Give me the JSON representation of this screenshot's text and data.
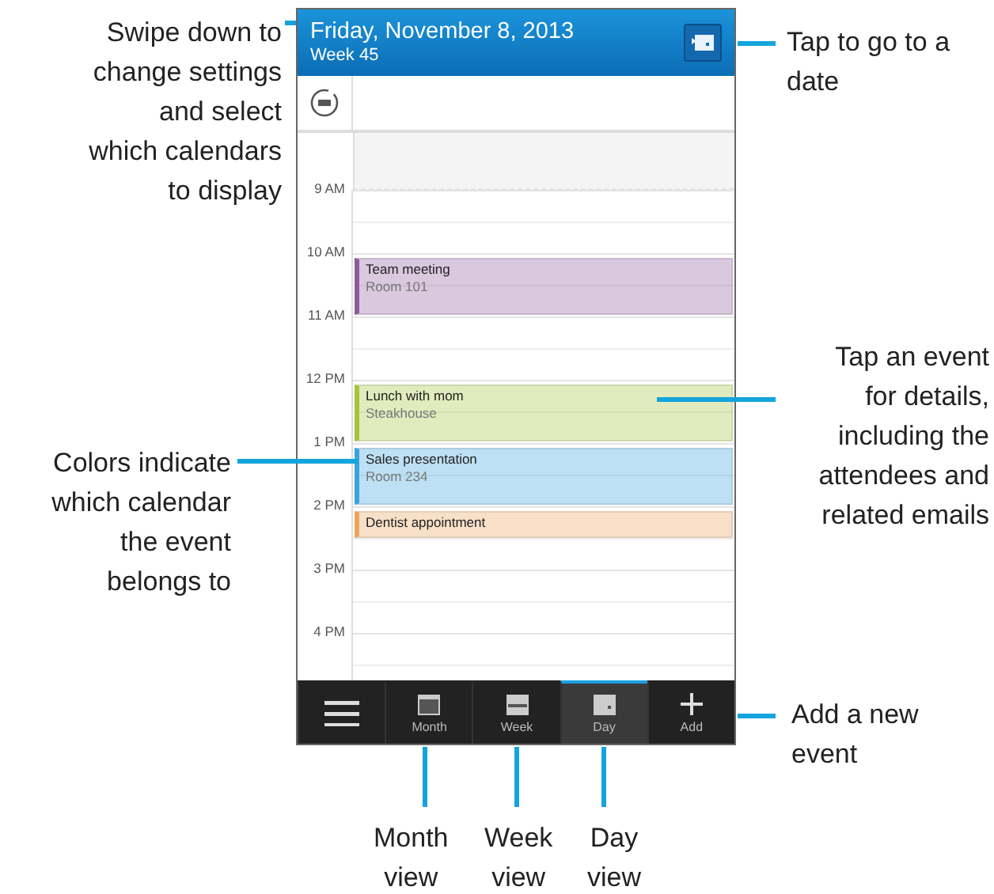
{
  "header": {
    "title": "Friday, November 8, 2013",
    "subtitle": "Week 45"
  },
  "hours": [
    {
      "label": "9 AM"
    },
    {
      "label": "10 AM",
      "events": [
        {
          "title": "Team meeting",
          "location": "Room 101",
          "color": "#8e5a9c",
          "kind": "hour"
        }
      ]
    },
    {
      "label": "11 AM"
    },
    {
      "label": "12 PM",
      "events": [
        {
          "title": "Lunch with mom",
          "location": "Steakhouse",
          "color": "#a6c33a",
          "kind": "hour"
        }
      ]
    },
    {
      "label": "1 PM",
      "events": [
        {
          "title": "Sales presentation",
          "location": "Room 234",
          "color": "#3aa3dd",
          "kind": "hour"
        }
      ]
    },
    {
      "label": "2 PM",
      "events": [
        {
          "title": "Dentist appointment",
          "color": "#eba35a",
          "kind": "half"
        }
      ]
    },
    {
      "label": "3 PM"
    },
    {
      "label": "4 PM"
    }
  ],
  "toolbar": [
    {
      "kind": "menu",
      "selected": false
    },
    {
      "kind": "month",
      "label": "Month",
      "selected": false
    },
    {
      "kind": "week",
      "label": "Week",
      "selected": false
    },
    {
      "kind": "day",
      "label": "Day",
      "selected": true
    },
    {
      "kind": "add",
      "label": "Add",
      "selected": false
    }
  ],
  "callouts": [
    {
      "kind": "left",
      "text": "Swipe down to\nchange settings\nand select\nwhich calendars\nto display"
    },
    {
      "kind": "right",
      "text": "Tap to go to a\ndate"
    },
    {
      "kind": "right-end",
      "text": "Tap an event\nfor details,\nincluding the\nattendees and\nrelated emails"
    },
    {
      "kind": "left",
      "text": "Colors indicate\nwhich calendar\nthe event\nbelongs to"
    },
    {
      "kind": "right",
      "text": "Add a new\nevent"
    },
    {
      "kind": "bottom",
      "text": "Month\nview"
    },
    {
      "kind": "bottom",
      "text": "Week\nview"
    },
    {
      "kind": "bottom",
      "text": "Day\nview"
    }
  ]
}
